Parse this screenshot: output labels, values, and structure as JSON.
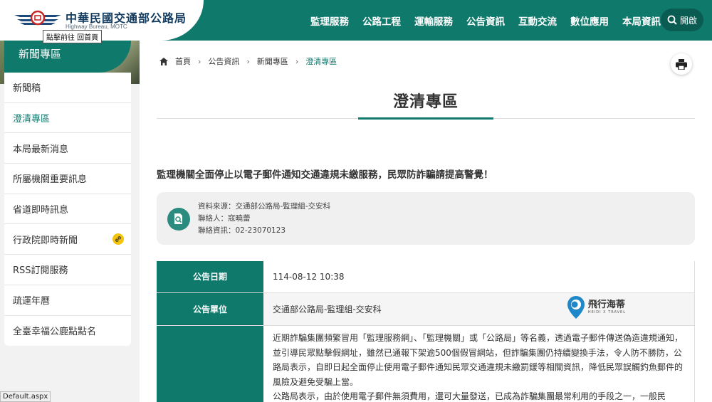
{
  "header": {
    "logo_title": "中華民國交通部公路局",
    "logo_sub": "Highway Bureau, MOTC",
    "tooltip": "點擊前往 回首頁",
    "nav": [
      "監理服務",
      "公路工程",
      "運輸服務",
      "公告資訊",
      "互動交流",
      "數位應用",
      "本局資訊"
    ],
    "open_label": "開啟"
  },
  "sidebar": {
    "heading": "新聞專區",
    "items": [
      {
        "label": "新聞稿"
      },
      {
        "label": "澄清專區"
      },
      {
        "label": "本局最新消息"
      },
      {
        "label": "所屬機關重要訊息"
      },
      {
        "label": "省道即時訊息"
      },
      {
        "label": "行政院即時新聞"
      },
      {
        "label": "RSS訂閱服務"
      },
      {
        "label": "疏運年曆"
      },
      {
        "label": "全臺幸福公鹿點點名"
      }
    ]
  },
  "status_bar": "Default.aspx",
  "breadcrumb": [
    "首頁",
    "公告資訊",
    "新聞專區",
    "澄清專區"
  ],
  "page_title": "澄清專區",
  "article": {
    "headline": "監理機關全面停止以電子郵件通知交通違規未繳服務，民眾防詐騙請提高警覺！",
    "source": "資料來源：交通部公路局-監理組-交安科",
    "contact": "聯絡人：寇曉蕾",
    "phone": "聯絡資訊：02-23070123",
    "table": {
      "date_label": "公告日期",
      "date_value": "114-08-12 10:38",
      "unit_label": "公告單位",
      "unit_value": "交通部公路局-監理組-交安科",
      "body_p1": "近期詐騙集團頻繁冒用「監理服務網」、「監理機關」或「公路局」等名義，透過電子郵件傳送偽造違規通知，並引導民眾點擊假網址，雖然已通報下架逾500個假冒網站，但詐騙集團仍持續變換手法，令人防不勝防，公路局表示，自即日起全面停止使用電子郵件通知民眾交通違規未繳罰鍰等相關資訊，降低民眾誤觸釣魚郵件的風險及避免受騙上當。",
      "body_p2": "公路局表示，由於使用電子郵件無須費用，還可大量發送，已成為詐騙集團最常利用的手段之一，一般民"
    }
  },
  "watermark": {
    "title": "飛行海蒂",
    "sub": "HEIDI X TRAVEL"
  }
}
